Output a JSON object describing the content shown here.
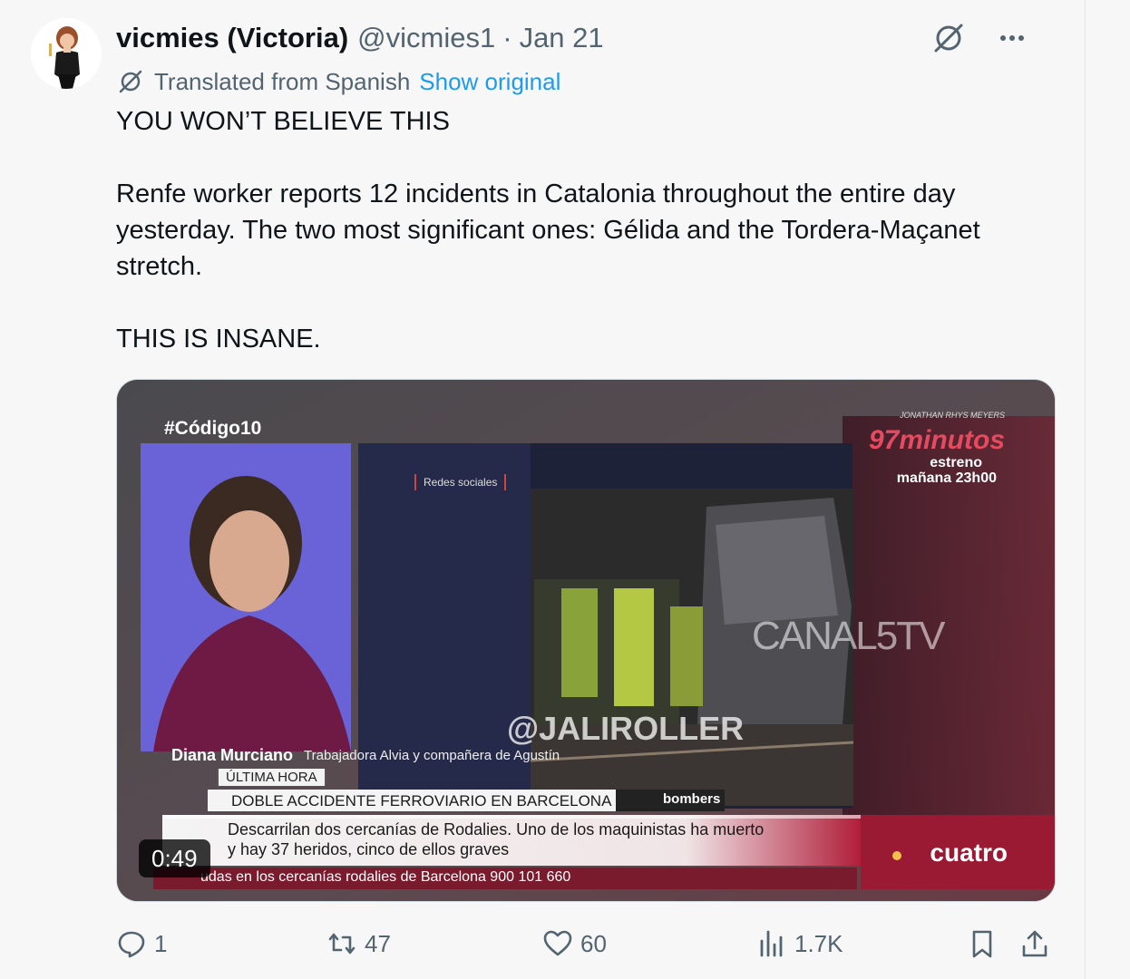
{
  "tweet": {
    "display_name": "vicmies (Victoria)",
    "handle": "@vicmies1",
    "separator": "·",
    "date": "Jan 21",
    "translation_label": "Translated from Spanish",
    "show_original": "Show original",
    "text": [
      "YOU WON’T BELIEVE THIS",
      "Renfe worker reports 12 incidents in Catalonia throughout the entire day yesterday. The two most significant ones: Gélida and the Tordera-Maçanet stretch.",
      "THIS IS INSANE."
    ]
  },
  "video": {
    "duration": "0:49",
    "overlay": {
      "hashtag": "#Código10",
      "promo_small": "JONATHAN RHYS MEYERS",
      "promo_title": "97minutos",
      "promo_line1": "estreno",
      "promo_line2": "mañana 23h00",
      "source_tag": "Redes sociales",
      "watermark": "CANAL5TV",
      "credit": "@JALIROLLER",
      "speaker_name": "Diana Murciano",
      "speaker_role": "Trabajadora Alvia y compañera de Agustín",
      "tag": "ÚLTIMA HORA",
      "headline": "DOBLE ACCIDENTE FERROVIARIO EN BARCELONA",
      "logo_source": "bombers",
      "desc_line1": "Descarrilan dos cercanías de Rodalies. Uno de los maquinistas ha muerto",
      "desc_line2": "y hay 37 heridos, cinco de ellos graves",
      "ticker": "udas en los cercanías rodalies de Barcelona  900 101 660",
      "channel": "cuatro"
    }
  },
  "actions": {
    "replies": "1",
    "reposts": "47",
    "likes": "60",
    "views": "1.7K"
  },
  "colors": {
    "accent": "#1d9bf0",
    "muted": "#536471",
    "text": "#0f1419"
  }
}
